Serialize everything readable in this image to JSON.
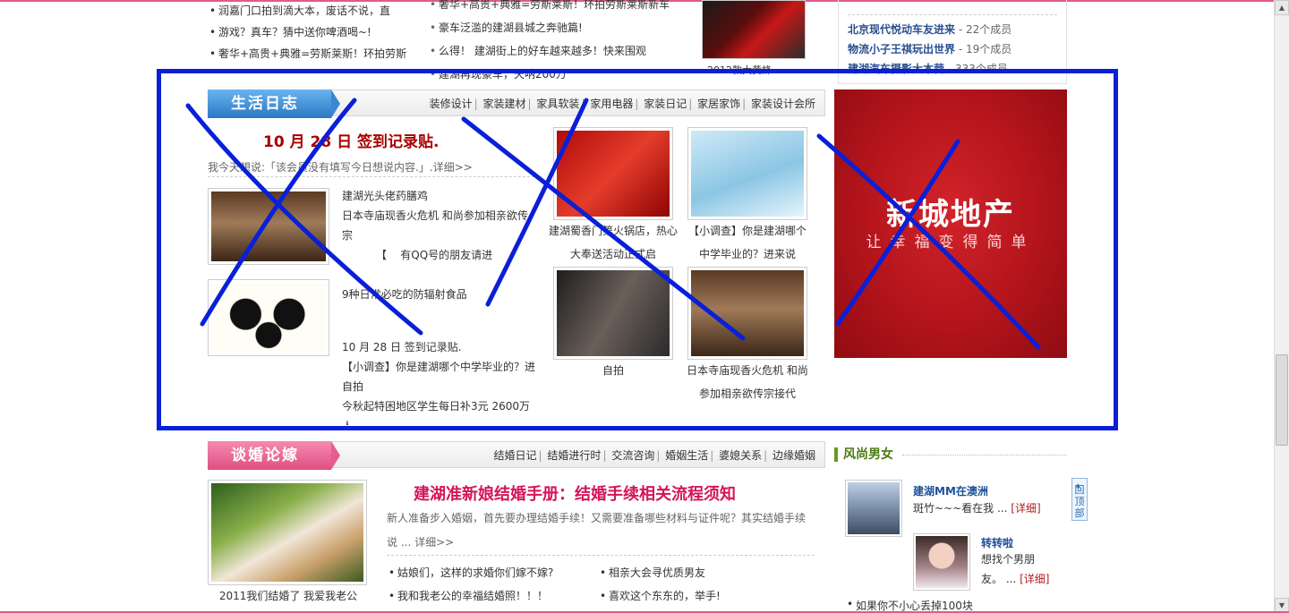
{
  "top": {
    "left_list": [
      "润嘉门口拍到滴大本，废话不说，直",
      "游戏？真车？猜中送你啤酒喝~!",
      "奢华+高贵+典雅=劳斯莱斯！环拍劳斯"
    ],
    "mid_list": [
      "奢华+高贵+典雅=劳斯莱斯！环拍劳斯莱斯新车",
      "豪车泛滥的建湖县城之奔驰篇!",
      "么得！ 建湖街上的好车越来越多！快来围观",
      "建湖再现豪车，天呐200万"
    ],
    "car_caption": "2012款大黄蜂",
    "groups": [
      {
        "name": "北京现代悦动车友进来",
        "count": " - 22个成员"
      },
      {
        "name": "物流小子王祺玩出世界",
        "count": " - 19个成员"
      },
      {
        "name": "建湖汽车摄影大本营",
        "count": " - 333个成员"
      }
    ]
  },
  "life": {
    "title": "生活日志",
    "nav": [
      "装修设计",
      "家装建材",
      "家具软装",
      "家用电器",
      "家装日记",
      "家居家饰",
      "家装设计会所"
    ],
    "headline": "10 月 28 日 签到记录贴.",
    "today": "我今天想说:「该会员没有填写今日想说内容.」.详细>>",
    "post1": {
      "title": "建湖光头佬药膳鸡",
      "line2": "日本寺庙现香火危机 和尚参加相亲欲传",
      "line3": "宗",
      "line4": "【    有QQ号的朋友请进"
    },
    "post2": "9种日常必吃的防辐射食品",
    "post3": {
      "line1": "10 月 28 日 签到记录贴.",
      "line2": "【小调查】你是建湖哪个中学毕业的？进",
      "line3": "自拍",
      "line4": "今秋起特困地区学生每日补3元 2600万",
      "line5": "人"
    },
    "captions": {
      "hotpot": "建湖蜀香门第火锅店，热心大奉送活动正式启",
      "survey": "【小调查】你是建湖哪个中学毕业的？进来说",
      "self": "自拍",
      "temple": "日本寺庙现香火危机 和尚参加相亲欲传宗接代"
    },
    "ad": {
      "title": "新城地产",
      "slogan": "让幸福变得简单",
      "brand_color": "#c4181f"
    }
  },
  "marry": {
    "title": "谈婚论嫁",
    "nav": [
      "结婚日记",
      "结婚进行时",
      "交流咨询",
      "婚姻生活",
      "婆媳关系",
      "边缘婚姻"
    ],
    "photo_caption": "2011我们结婚了 我爱我老公",
    "headline": "建湖准新娘结婚手册：结婚手续相关流程须知",
    "desc": "新人准备步入婚姻，首先要办理结婚手续！又需要准备哪些材料与证件呢？其实结婚手续说 ... 详细>>",
    "list_left": [
      "姑娘们，这样的求婚你们嫁不嫁?",
      "我和我老公的幸福结婚照！！！"
    ],
    "list_right": [
      "相亲大会寻优质男友",
      "喜欢这个东东的，举手!"
    ]
  },
  "fashion": {
    "title": "风尚男女",
    "item1": {
      "name": "建湖MM在澳洲",
      "text": "斑竹~~~看在我 ...",
      "more": "[详细]"
    },
    "item2": {
      "name": "转转啦",
      "text1": "想找个男朋",
      "text2": "友。 ...",
      "more": "[详细]"
    },
    "last": "如果你不小心丢掉100块",
    "back_top": "回顶部"
  },
  "annotation_color": "#0a1fd8"
}
